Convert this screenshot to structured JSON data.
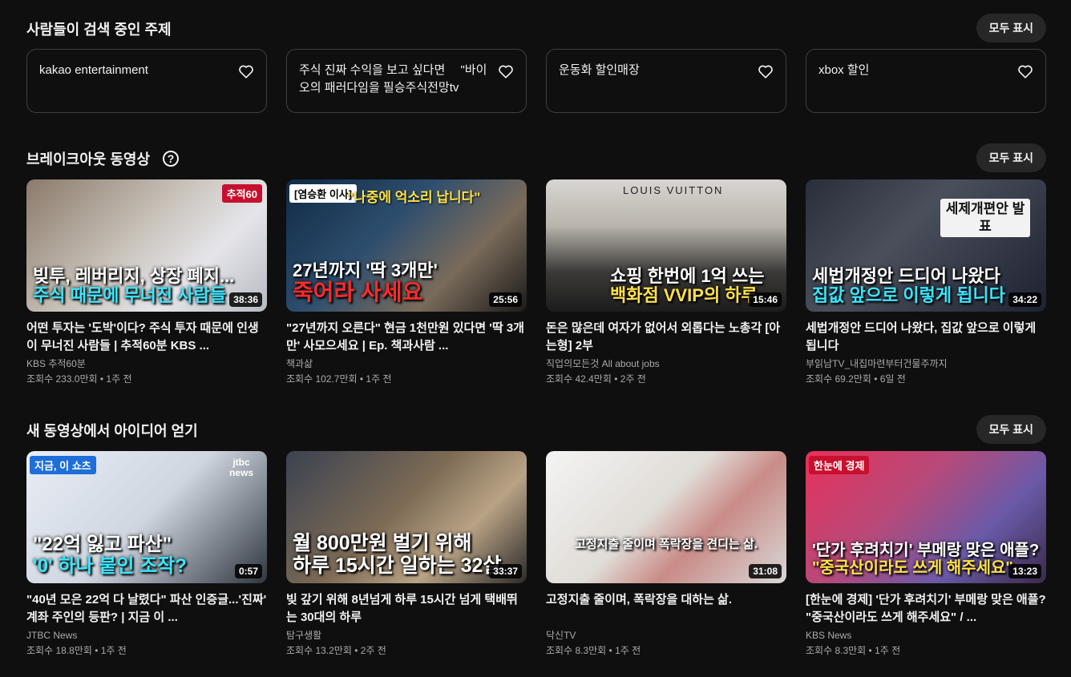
{
  "topics_section": {
    "title": "사람들이 검색 중인 주제",
    "show_all": "모두 표시",
    "items": [
      {
        "label": "kakao entertainment"
      },
      {
        "label": "주식 진짜 수익을 보고 싶다면 　\"바이오의 패러다임을 필승주식전망tv"
      },
      {
        "label": "운동화 할인매장"
      },
      {
        "label": "xbox 할인"
      }
    ]
  },
  "breakout_section": {
    "title": "브레이크아웃 동영상",
    "help": "?",
    "show_all": "모두 표시",
    "videos": [
      {
        "title": "어떤 투자는 '도박'이다? 주식 투자 때문에 인생이 무너진 사람들 | 추적60분 KBS ...",
        "channel": "KBS 추적60분",
        "meta": "조회수 233.0만회 • 1주 전",
        "duration": "38:36",
        "tag": "추적60",
        "cap1": "빚투, 레버리지, 상장 폐지...",
        "cap2": "주식 때문에 무너진 사람들"
      },
      {
        "title": "\"27년까지 오른다\" 현금 1천만원 있다면 '딱 3개만' 사모으세요 | Ep. 책과사람 ...",
        "channel": "책과삶",
        "meta": "조회수 102.7만회 • 1주 전",
        "duration": "25:56",
        "tag": "[염승환 이사]",
        "tag2": "\"나중에 억소리 납니다\"",
        "cap1": "27년까지 '딱 3개만'",
        "cap2": "죽어라 사세요"
      },
      {
        "title": "돈은 많은데 여자가 없어서 외롭다는 노총각 [아는형] 2부",
        "channel": "직업의모든것 All about jobs",
        "meta": "조회수 42.4만회 • 2주 전",
        "duration": "15:46",
        "tag": "LOUIS VUITTON",
        "cap1": "쇼핑 한번에 1억 쓰는",
        "cap2": "백화점 VVIP의 하루"
      },
      {
        "title": "세법개정안 드디어 나왔다, 집값 앞으로 이렇게 됩니다",
        "channel": "부읽남TV_내집마련부터건물주까지",
        "meta": "조회수 69.2만회 • 6일 전",
        "duration": "34:22",
        "tag": "세제개편안 발표",
        "cap1": "세법개정안 드디어 나왔다",
        "cap2": "집값 앞으로 이렇게 됩니다"
      }
    ]
  },
  "ideas_section": {
    "title": "새 동영상에서 아이디어 얻기",
    "show_all": "모두 표시",
    "videos": [
      {
        "title": "\"40년 모은 22억 다 날렸다\" 파산 인증글...'진짜' 계좌 주인의 등판? | 지금 이 ...",
        "channel": "JTBC News",
        "meta": "조회수 18.8만회 • 1주 전",
        "duration": "0:57",
        "tag": "지금, 이 쇼츠",
        "tag2": "jtbc news",
        "cap1": "\"22억 잃고 파산\"",
        "cap2": "'0' 하나 붙인 조작?"
      },
      {
        "title": "빚 갚기 위해 8년넘게 하루 15시간 넘게 택배뛰는 30대의 하루",
        "channel": "탐구생활",
        "meta": "조회수 13.2만회 • 2주 전",
        "duration": "33:37",
        "tag": "",
        "cap1": "월 800만원 벌기 위해",
        "cap2": "하루 15시간 일하는 32살"
      },
      {
        "title": "고정지출 줄이며, 폭락장을 대하는 삶.",
        "channel": "닥신TV",
        "meta": "조회수 8.3만회 • 1주 전",
        "duration": "31:08",
        "tag": "",
        "cap1": "고정지출 줄이며 폭락장을 견디는 삶.",
        "cap2": ""
      },
      {
        "title": "[한눈에 경제] '단가 후려치기' 부메랑 맞은 애플? \"중국산이라도 쓰게 해주세요\" / ...",
        "channel": "KBS News",
        "meta": "조회수 8.3만회 • 1주 전",
        "duration": "13:23",
        "tag": "한눈에 경제",
        "cap1": "'단가 후려치기' 부메랑 맞은 애플?",
        "cap2": "\"중국산이라도 쓰게 해주세요\""
      }
    ]
  }
}
